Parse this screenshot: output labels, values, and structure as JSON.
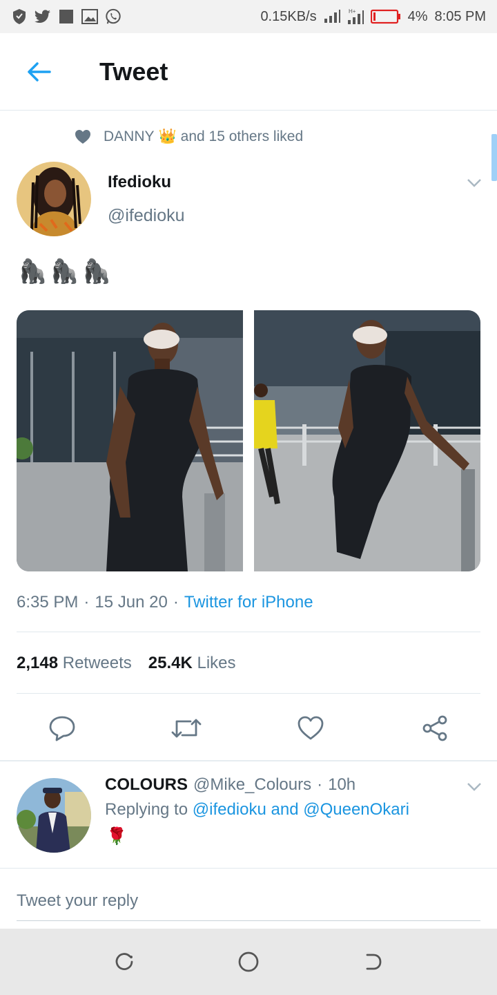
{
  "status_bar": {
    "net_speed": "0.15KB/s",
    "battery": "4%",
    "time": "8:05 PM",
    "icons": [
      "shield-icon",
      "twitter-icon",
      "square-icon",
      "gallery-icon",
      "whatsapp-icon",
      "signal-icon",
      "signal-4g-icon",
      "battery-icon"
    ]
  },
  "header": {
    "title": "Tweet",
    "back_icon": "arrow-left-icon"
  },
  "tweet": {
    "social_context": {
      "icon": "heart-icon",
      "name": "DANNY",
      "crown": "👑",
      "rest": "and 15 others liked"
    },
    "author": {
      "name": "Ifedioku",
      "handle": "@ifedioku"
    },
    "text": "🦍🦍🦍",
    "meta": {
      "time": "6:35 PM",
      "sep1": "·",
      "date": "15 Jun 20",
      "sep2": "·",
      "source": "Twitter for iPhone"
    },
    "stats": {
      "retweets": "2,148",
      "retweets_label": "Retweets",
      "likes": "25.4K",
      "likes_label": "Likes"
    },
    "actions": [
      "reply-icon",
      "retweet-icon",
      "like-icon",
      "share-icon"
    ]
  },
  "reply": {
    "name": "COLOURS",
    "handle": "@Mike_Colours",
    "sep": "·",
    "time": "10h",
    "replying_prefix": "Replying to",
    "mentions": "@ifedioku and @QueenOkari",
    "text": "🌹"
  },
  "composer": {
    "placeholder": "Tweet your reply"
  },
  "colors": {
    "accent": "#1da1f2",
    "link": "#1b95e0",
    "muted": "#657786"
  }
}
